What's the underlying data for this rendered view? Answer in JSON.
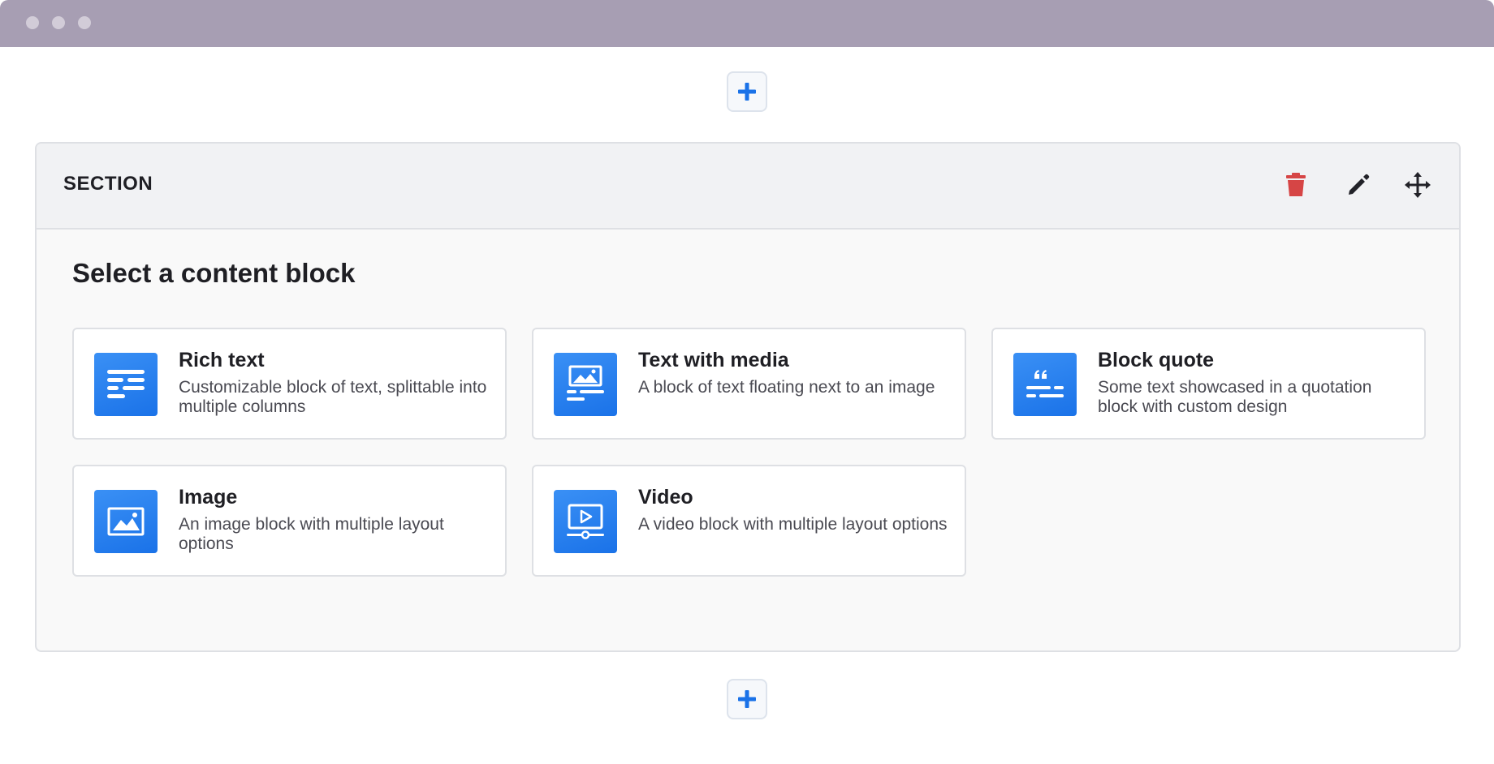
{
  "window": {
    "controls": [
      "window-dot",
      "window-dot",
      "window-dot"
    ]
  },
  "add_buttons": {
    "top_icon": "plus-icon",
    "bottom_icon": "plus-icon",
    "accent_color": "#1a72e8"
  },
  "section": {
    "title": "SECTION",
    "actions": {
      "delete_icon": "trash-icon",
      "delete_color": "#d64545",
      "edit_icon": "pencil-icon",
      "move_icon": "move-arrows-icon"
    },
    "prompt": "Select a content block",
    "blocks": [
      {
        "title": "Rich text",
        "description": "Customizable block of text, splittable into multiple columns",
        "icon": "rich-text-icon"
      },
      {
        "title": "Text with media",
        "description": "A block of text floating next to an image",
        "icon": "text-with-media-icon"
      },
      {
        "title": "Block quote",
        "description": "Some text showcased in a quotation block with custom design",
        "icon": "block-quote-icon"
      },
      {
        "title": "Image",
        "description": "An image block with multiple layout options",
        "icon": "image-icon"
      },
      {
        "title": "Video",
        "description": "A video block with multiple layout options",
        "icon": "video-icon"
      }
    ],
    "icon_color": "#2a84f2"
  }
}
